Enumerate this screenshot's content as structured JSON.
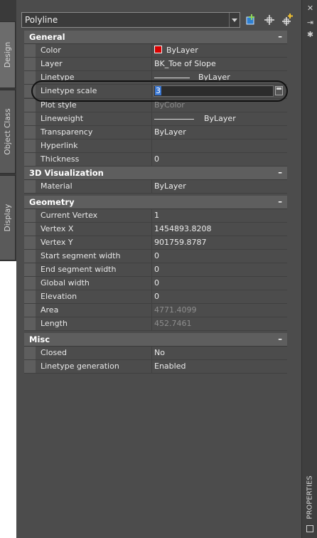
{
  "tabs": [
    "Design",
    "Object Class",
    "Display"
  ],
  "palette_title": "PROPERTIES",
  "object_select": {
    "value": "Polyline"
  },
  "categories": {
    "general": {
      "title": "General",
      "rows": {
        "color": {
          "label": "Color",
          "value": "ByLayer"
        },
        "layer": {
          "label": "Layer",
          "value": "BK_Toe of Slope"
        },
        "linetype": {
          "label": "Linetype",
          "value": "ByLayer"
        },
        "linetype_scale": {
          "label": "Linetype scale",
          "value": "3"
        },
        "plot_style": {
          "label": "Plot style",
          "value": "ByColor"
        },
        "lineweight": {
          "label": "Lineweight",
          "value": "ByLayer"
        },
        "transparency": {
          "label": "Transparency",
          "value": "ByLayer"
        },
        "hyperlink": {
          "label": "Hyperlink",
          "value": ""
        },
        "thickness": {
          "label": "Thickness",
          "value": "0"
        }
      }
    },
    "visualization": {
      "title": "3D Visualization",
      "rows": {
        "material": {
          "label": "Material",
          "value": "ByLayer"
        }
      }
    },
    "geometry": {
      "title": "Geometry",
      "rows": {
        "current_vertex": {
          "label": "Current Vertex",
          "value": "1"
        },
        "vertex_x": {
          "label": "Vertex X",
          "value": "1454893.8208"
        },
        "vertex_y": {
          "label": "Vertex Y",
          "value": "901759.8787"
        },
        "start_width": {
          "label": "Start segment width",
          "value": "0"
        },
        "end_width": {
          "label": "End segment width",
          "value": "0"
        },
        "global_width": {
          "label": "Global width",
          "value": "0"
        },
        "elevation": {
          "label": "Elevation",
          "value": "0"
        },
        "area": {
          "label": "Area",
          "value": "4771.4099"
        },
        "length": {
          "label": "Length",
          "value": "452.7461"
        }
      }
    },
    "misc": {
      "title": "Misc",
      "rows": {
        "closed": {
          "label": "Closed",
          "value": "No"
        },
        "linetype_generation": {
          "label": "Linetype generation",
          "value": "Enabled"
        }
      }
    }
  },
  "collapse_symbol": "–",
  "colors": {
    "swatch": "#d80000",
    "selection": "#3b78d4",
    "highlight_oval": "#111111"
  },
  "icons": [
    "quick-select-icon",
    "select-objects-icon",
    "toggle-pickadd-icon",
    "close-icon",
    "auto-hide-icon",
    "palette-properties-icon",
    "chevron-down-icon",
    "calculator-icon"
  ]
}
